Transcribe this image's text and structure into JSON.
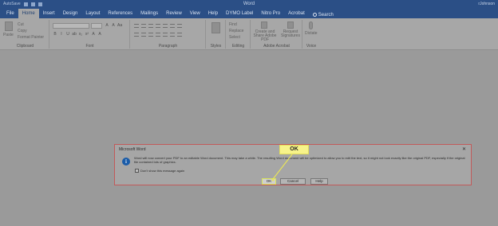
{
  "titlebar": {
    "title": "Word",
    "user": "rJohnson",
    "brand": "AutoSave"
  },
  "menu": {
    "tabs": [
      "File",
      "Home",
      "Insert",
      "Design",
      "Layout",
      "References",
      "Mailings",
      "Review",
      "View",
      "Help",
      "DYMO Label",
      "Nitro Pro",
      "Acrobat"
    ],
    "active_tab": "Home",
    "search_label": "Search"
  },
  "ribbon": {
    "clipboard": {
      "paste": "Paste",
      "cut": "Cut",
      "copy": "Copy",
      "format_painter": "Format Painter",
      "label": "Clipboard"
    },
    "font": {
      "label": "Font",
      "format_buttons": [
        "B",
        "I",
        "U",
        "ab",
        "x₂",
        "x²",
        "A",
        "A"
      ]
    },
    "paragraph": {
      "label": "Paragraph"
    },
    "styles": {
      "label": "Styles"
    },
    "editing": {
      "label": "Editing",
      "find": "Find",
      "replace": "Replace",
      "select": "Select"
    },
    "adobe": {
      "label": "Adobe Acrobat",
      "create_share": "Create and Share Adobe PDF",
      "request_signatures": "Request Signatures"
    },
    "voice": {
      "label": "Voice",
      "dictate": "Dictate"
    }
  },
  "dialog": {
    "title": "Microsoft Word",
    "close": "✕",
    "message": "Word will now convert your PDF to an editable Word document. This may take a while. The resulting Word document will be optimized to allow you to edit the text, so it might not look exactly like the original PDF, especially if the original file contained lots of graphics.",
    "checkbox_label": "Don't show this message again",
    "ok": "OK",
    "cancel": "Cancel",
    "help": "Help"
  },
  "callout": {
    "label": "OK"
  },
  "colors": {
    "titlebar": "#2b4f86",
    "ribbon": "#a7a7a7",
    "callout": "#f7f38a",
    "dialog_border": "#c25a5a",
    "info_icon": "#1b5ca8"
  }
}
